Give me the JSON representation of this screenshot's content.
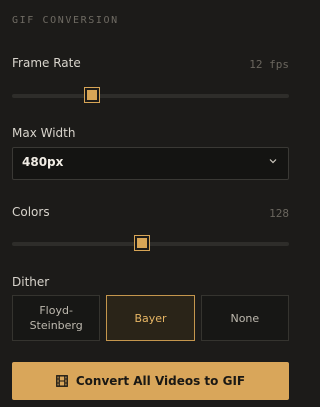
{
  "section": {
    "title": "GIF CONVERSION"
  },
  "frame_rate": {
    "label": "Frame Rate",
    "value_text": "12 fps",
    "level": 0.29
  },
  "max_width": {
    "label": "Max Width",
    "selected": "480px"
  },
  "colors": {
    "label": "Colors",
    "value_text": "128",
    "level": 0.47
  },
  "dither": {
    "label": "Dither",
    "options": [
      "Floyd-Steinberg",
      "Bayer",
      "None"
    ],
    "option_line1": "Floyd-",
    "option_line2": "Steinberg",
    "selected": "Bayer"
  },
  "convert": {
    "label": "Convert All Videos to GIF",
    "icon": "film-icon"
  },
  "colors_theme": {
    "accent": "#d9a65a",
    "background": "#1c1b19"
  }
}
